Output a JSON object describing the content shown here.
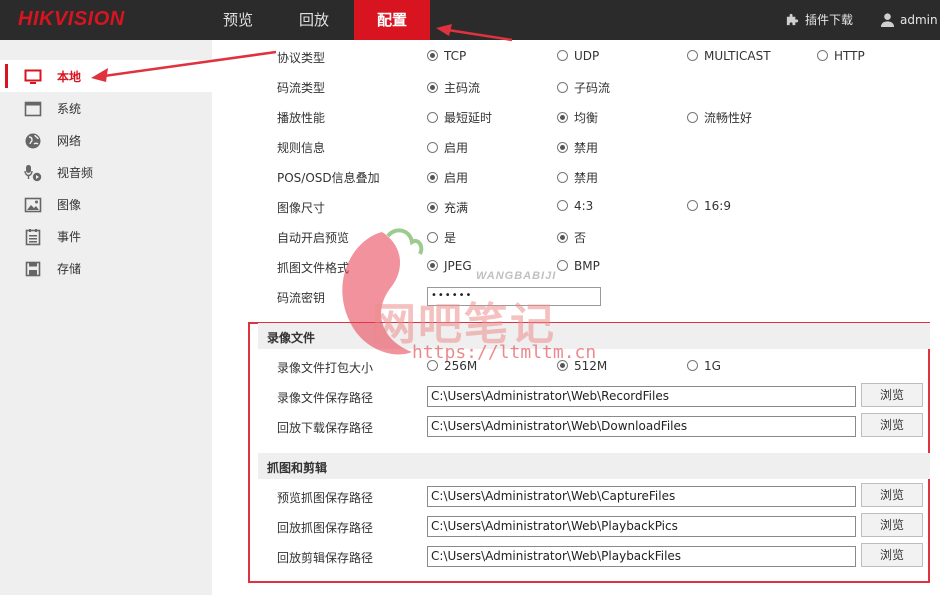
{
  "brand": {
    "logo_text": "HIKVISION",
    "accent_color": "#d7141f"
  },
  "topnav": {
    "tabs": [
      {
        "label": "预览",
        "active": false
      },
      {
        "label": "回放",
        "active": false
      },
      {
        "label": "配置",
        "active": true
      }
    ],
    "plugin_download": "插件下载",
    "user": "admin"
  },
  "sidebar": {
    "items": [
      {
        "label": "本地",
        "icon": "monitor-icon",
        "active": true
      },
      {
        "label": "系统",
        "icon": "system-window-icon",
        "active": false
      },
      {
        "label": "网络",
        "icon": "globe-icon",
        "active": false
      },
      {
        "label": "视音频",
        "icon": "microphone-icon",
        "active": false
      },
      {
        "label": "图像",
        "icon": "image-icon",
        "active": false
      },
      {
        "label": "事件",
        "icon": "event-list-icon",
        "active": false
      },
      {
        "label": "存储",
        "icon": "storage-disk-icon",
        "active": false
      }
    ]
  },
  "params": {
    "protocol": {
      "label": "协议类型",
      "options": [
        "TCP",
        "UDP",
        "MULTICAST",
        "HTTP"
      ],
      "selected": "TCP"
    },
    "stream": {
      "label": "码流类型",
      "options": [
        "主码流",
        "子码流"
      ],
      "selected": "主码流"
    },
    "play_perf": {
      "label": "播放性能",
      "options": [
        "最短延时",
        "均衡",
        "流畅性好"
      ],
      "selected": "均衡"
    },
    "rules": {
      "label": "规则信息",
      "options": [
        "启用",
        "禁用"
      ],
      "selected": "禁用"
    },
    "pos_osd": {
      "label": "POS/OSD信息叠加",
      "options": [
        "启用",
        "禁用"
      ],
      "selected": "启用"
    },
    "image_size": {
      "label": "图像尺寸",
      "options": [
        "充满",
        "4:3",
        "16:9"
      ],
      "selected": "充满"
    },
    "auto_preview": {
      "label": "自动开启预览",
      "options": [
        "是",
        "否"
      ],
      "selected": "否"
    },
    "capture_format": {
      "label": "抓图文件格式",
      "options": [
        "JPEG",
        "BMP"
      ],
      "selected": "JPEG"
    },
    "stream_key": {
      "label": "码流密钥",
      "value": "••••••"
    }
  },
  "record": {
    "title": "录像文件",
    "pack_size": {
      "label": "录像文件打包大小",
      "options": [
        "256M",
        "512M",
        "1G"
      ],
      "selected": "512M"
    },
    "save_path": {
      "label": "录像文件保存路径",
      "value": "C:\\Users\\Administrator\\Web\\RecordFiles"
    },
    "download_path": {
      "label": "回放下载保存路径",
      "value": "C:\\Users\\Administrator\\Web\\DownloadFiles"
    }
  },
  "capture": {
    "title": "抓图和剪辑",
    "preview_path": {
      "label": "预览抓图保存路径",
      "value": "C:\\Users\\Administrator\\Web\\CaptureFiles"
    },
    "playback_pic_path": {
      "label": "回放抓图保存路径",
      "value": "C:\\Users\\Administrator\\Web\\PlaybackPics"
    },
    "playback_clip_path": {
      "label": "回放剪辑保存路径",
      "value": "C:\\Users\\Administrator\\Web\\PlaybackFiles"
    }
  },
  "browse_label": "浏览",
  "watermark": {
    "brand": "网吧笔记",
    "brand_latin": "WANGBABIJI",
    "url": "https://ltmltm.cn"
  }
}
